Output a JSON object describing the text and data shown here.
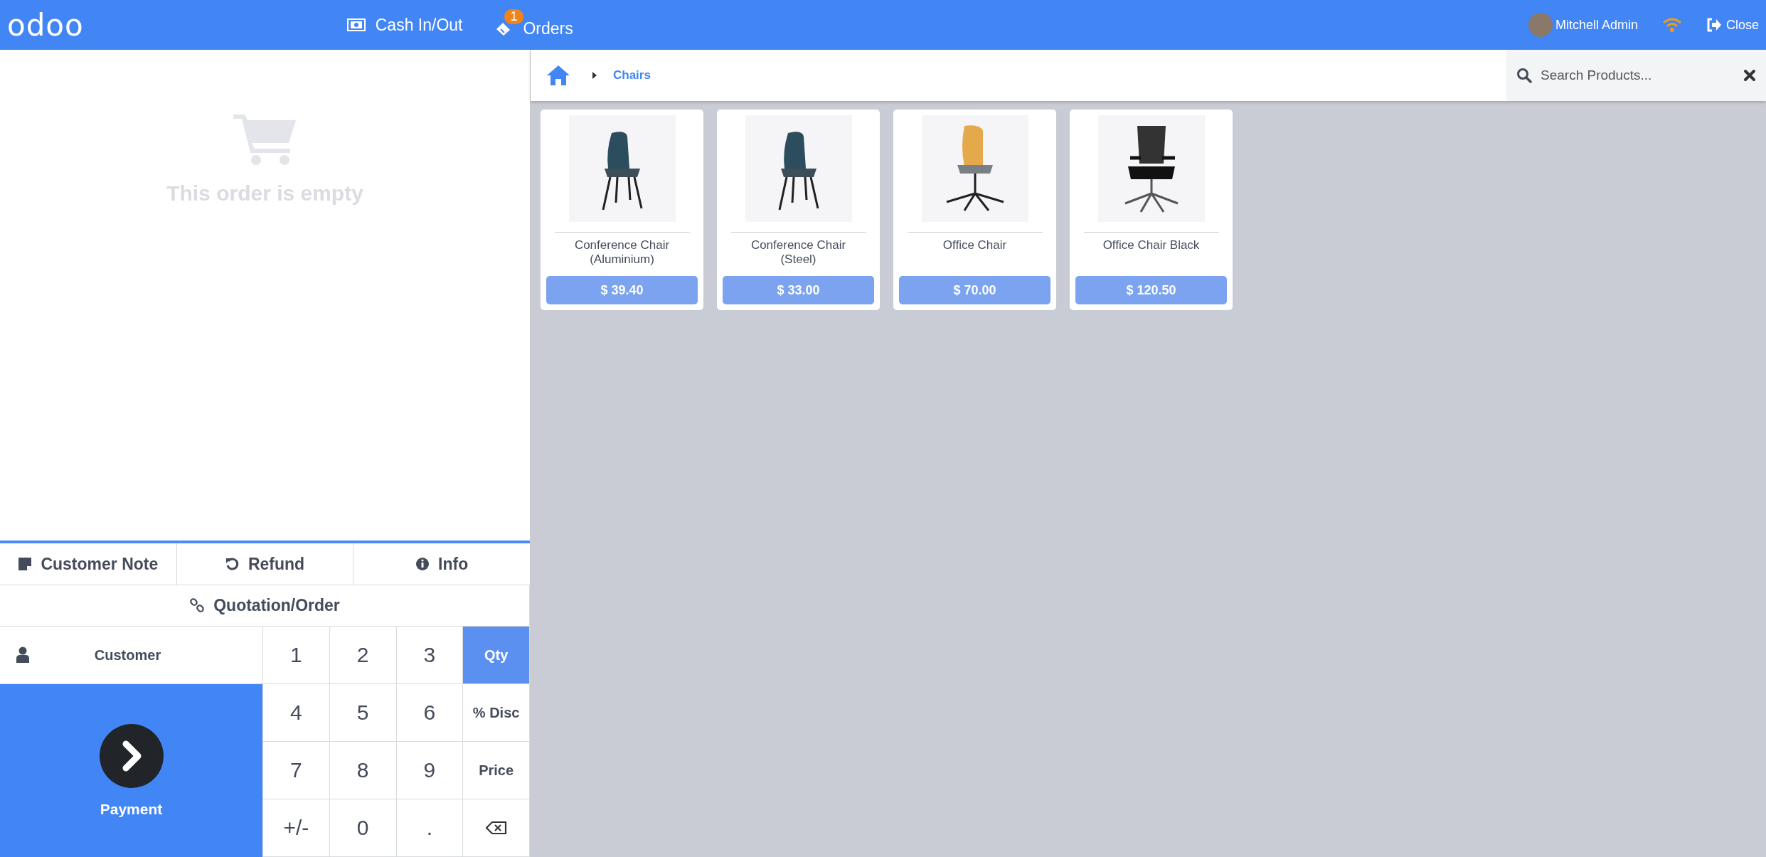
{
  "header": {
    "logo": "odoo",
    "cash": "Cash In/Out",
    "orders": {
      "label": "Orders",
      "badge": "1"
    },
    "user": "Mitchell Admin",
    "close": "Close"
  },
  "order": {
    "empty_text": "This order is empty"
  },
  "actions": [
    {
      "label": "Customer Note",
      "kind": "note"
    },
    {
      "label": "Refund",
      "kind": "refund"
    },
    {
      "label": "Info",
      "kind": "info"
    }
  ],
  "quotation": "Quotation/Order",
  "customer": "Customer",
  "payment": "Payment",
  "numpad": [
    {
      "label": "1",
      "kind": "digit",
      "selected": false
    },
    {
      "label": "2",
      "kind": "digit",
      "selected": false
    },
    {
      "label": "3",
      "kind": "digit",
      "selected": false
    },
    {
      "label": "Qty",
      "kind": "mode",
      "selected": true
    },
    {
      "label": "4",
      "kind": "digit",
      "selected": false
    },
    {
      "label": "5",
      "kind": "digit",
      "selected": false
    },
    {
      "label": "6",
      "kind": "digit",
      "selected": false
    },
    {
      "label": "% Disc",
      "kind": "mode",
      "selected": false
    },
    {
      "label": "7",
      "kind": "digit",
      "selected": false
    },
    {
      "label": "8",
      "kind": "digit",
      "selected": false
    },
    {
      "label": "9",
      "kind": "digit",
      "selected": false
    },
    {
      "label": "Price",
      "kind": "mode",
      "selected": false
    },
    {
      "label": "+/-",
      "kind": "digit",
      "selected": false
    },
    {
      "label": "0",
      "kind": "digit",
      "selected": false
    },
    {
      "label": ".",
      "kind": "digit",
      "selected": false
    },
    {
      "kind": "backspace",
      "selected": false
    }
  ],
  "breadcrumb": [
    "Chairs"
  ],
  "search": {
    "placeholder": "Search Products..."
  },
  "products": [
    {
      "name": "Conference Chair (Aluminium)",
      "price": "$ 39.40",
      "kind": "shell"
    },
    {
      "name": "Conference Chair (Steel)",
      "price": "$ 33.00",
      "kind": "shell"
    },
    {
      "name": "Office Chair",
      "price": "$ 70.00",
      "kind": "swivel"
    },
    {
      "name": "Office Chair Black",
      "price": "$ 120.50",
      "kind": "mesh"
    }
  ]
}
